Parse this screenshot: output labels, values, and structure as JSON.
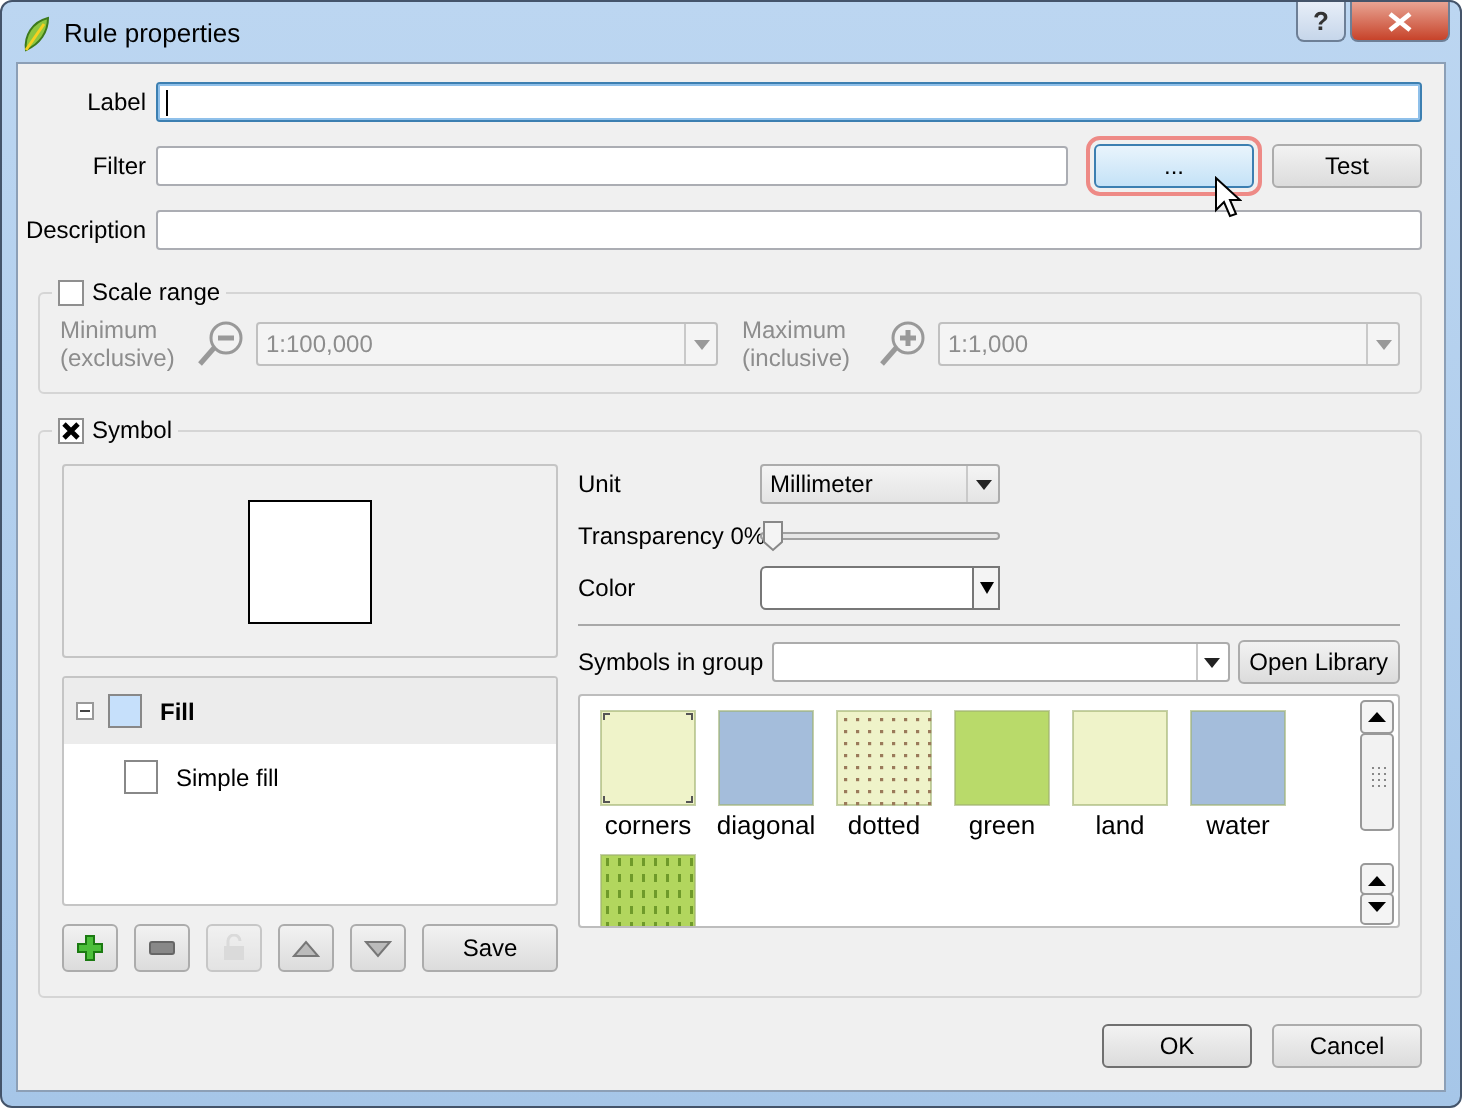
{
  "window": {
    "title": "Rule properties",
    "help": "?"
  },
  "label_field": {
    "label": "Label",
    "focused": true
  },
  "filter": {
    "label": "Filter",
    "builder_button": {
      "label": "...",
      "highlighted": true
    },
    "test_button": "Test"
  },
  "description": {
    "label": "Description"
  },
  "scale_range": {
    "title": "Scale range",
    "checked": false,
    "disabled": true,
    "minimum": {
      "label": "Minimum (exclusive)",
      "value": "1:100,000"
    },
    "maximum": {
      "label": "Maximum (inclusive)",
      "value": "1:1,000"
    }
  },
  "symbol": {
    "title": "Symbol",
    "checked": true,
    "tree": [
      {
        "label": "Fill",
        "selected": true,
        "expanded": true,
        "children": [
          {
            "label": "Simple fill",
            "selected": false
          }
        ]
      }
    ],
    "tool_buttons": [
      {
        "kind": "add",
        "disabled": false
      },
      {
        "kind": "remove",
        "disabled": false
      },
      {
        "kind": "lock",
        "disabled": true
      },
      {
        "kind": "up",
        "disabled": false
      },
      {
        "kind": "down",
        "disabled": false
      }
    ],
    "save_button": "Save",
    "unit": {
      "label": "Unit",
      "value": "Millimeter"
    },
    "transparency": {
      "label": "Transparency 0%",
      "level": 0
    },
    "color": {
      "label": "Color"
    },
    "symbols_in_group": {
      "label": "Symbols in group"
    },
    "open_library": "Open Library",
    "symbols": [
      {
        "name": "corners",
        "kind": "corners",
        "color": "#eff3c9"
      },
      {
        "name": "diagonal",
        "kind": "plain",
        "color": "#a4bddb"
      },
      {
        "name": "dotted",
        "kind": "dots",
        "color": "#eff3c9"
      },
      {
        "name": "green",
        "kind": "plain",
        "color": "#b9da6a"
      },
      {
        "name": "land",
        "kind": "plain",
        "color": "#eff3c9"
      },
      {
        "name": "water",
        "kind": "plain",
        "color": "#a4bddb"
      },
      {
        "kind": "dashes",
        "color": "#b2d65e"
      }
    ]
  },
  "buttons": [
    {
      "label": "OK",
      "default": true
    },
    {
      "label": "Cancel",
      "default": false
    }
  ]
}
